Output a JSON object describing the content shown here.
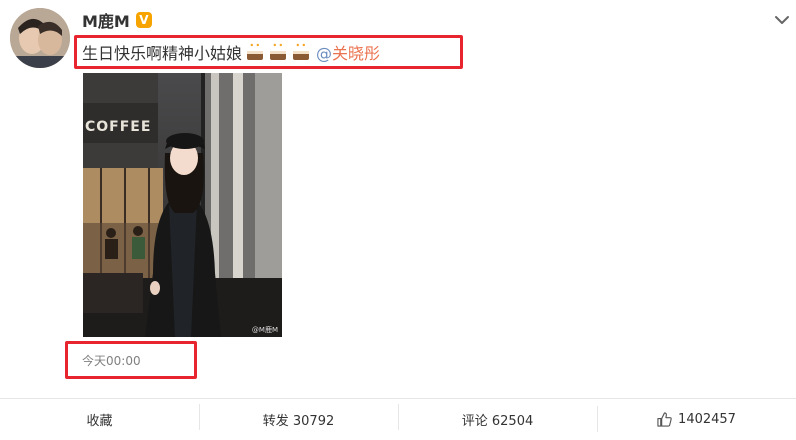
{
  "post": {
    "author": "M鹿M",
    "verified_badge": "V",
    "text": "生日快乐啊精神小姑娘",
    "emoji": [
      "cake-emoji",
      "cake-emoji",
      "cake-emoji"
    ],
    "mention_at": "@",
    "mention_name": "关晓彤",
    "photo_sign": "COFFEE",
    "photo_watermark": "@M鹿M",
    "timestamp": "今天00:00"
  },
  "actions": {
    "favorite_label": "收藏",
    "repost_label": "转发 30792",
    "comment_label": "评论 62504",
    "like_count": "1402457"
  },
  "colors": {
    "highlight": "#e8252e",
    "mention": "#eb7350",
    "verified": "#f7a400"
  }
}
